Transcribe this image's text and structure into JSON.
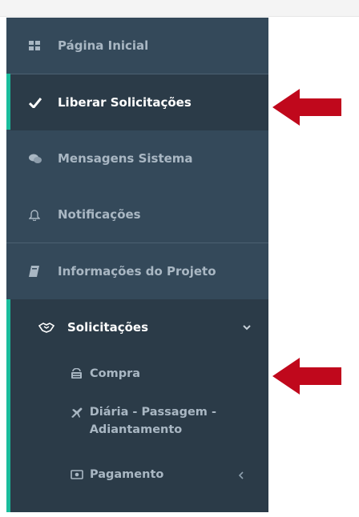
{
  "sidebar": {
    "items": [
      {
        "label": "Página Inicial",
        "icon": "grid-icon"
      },
      {
        "label": "Liberar Solicitações",
        "icon": "checkmark-icon"
      },
      {
        "label": "Mensagens Sistema",
        "icon": "chat-bubbles-icon"
      },
      {
        "label": "Notificações",
        "icon": "bell-icon"
      },
      {
        "label": "Informações do Projeto",
        "icon": "book-icon"
      }
    ],
    "group": {
      "label": "Solicitações",
      "icon": "handshake-icon",
      "chevron": "chevron-down-icon",
      "subitems": [
        {
          "label": "Compra",
          "icon": "basket-icon"
        },
        {
          "label": "Diária - Passagem - Adiantamento",
          "icon": "plane-icon"
        },
        {
          "label": "Pagamento",
          "icon": "money-icon",
          "chevron": "chevron-left-icon"
        }
      ]
    }
  },
  "colors": {
    "sidebar_bg": "#34495a",
    "active_bg": "#2b3b48",
    "accent": "#1abc9c",
    "text": "#a9b7c3",
    "arrow": "#c0081c"
  }
}
